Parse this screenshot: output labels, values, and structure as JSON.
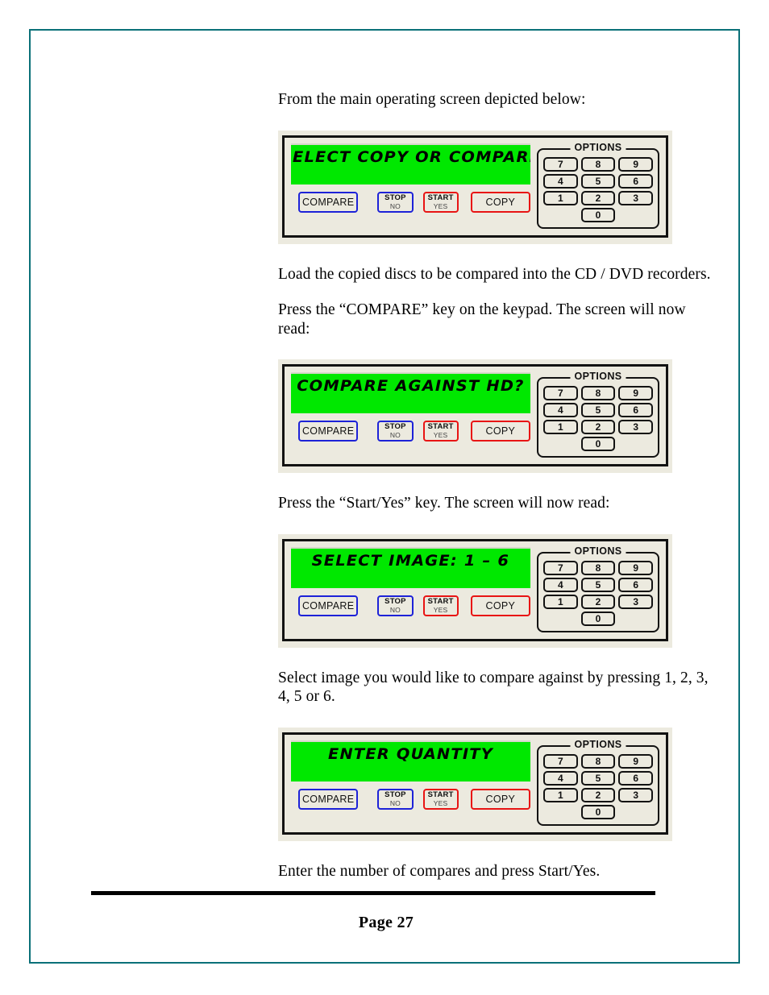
{
  "page": {
    "border_color": "#0a7078",
    "footer_page_label": "Page 27"
  },
  "paragraphs": {
    "intro": "From the main operating screen depicted below:",
    "load_discs": "Load the copied discs to be compared into the CD / DVD recorders.",
    "press_compare": "Press the “COMPARE” key on the keypad. The screen will now read:",
    "press_start_yes": "Press the “Start/Yes” key. The screen will now read:",
    "select_image": "Select image you would like to compare against by pressing 1, 2, 3, 4, 5 or 6.",
    "enter_compares": "Enter the number of compares and press Start/Yes."
  },
  "panel_common": {
    "lcd_color": "#00e800",
    "panel_bg": "#eceadf",
    "keypad_legend": "OPTIONS",
    "keypad_keys": [
      "7",
      "8",
      "9",
      "4",
      "5",
      "6",
      "1",
      "2",
      "3"
    ],
    "keypad_zero": "0",
    "buttons": {
      "compare": {
        "label": "COMPARE",
        "color": "#1d22d8"
      },
      "stop": {
        "line1": "STOP",
        "line2": "NO",
        "color": "#1d22d8"
      },
      "start": {
        "line1": "START",
        "line2": "YES",
        "color": "#e81414"
      },
      "copy": {
        "label": "COPY",
        "color": "#e81414"
      }
    }
  },
  "panels": [
    {
      "id": "panel-select-copy-or-compare",
      "lcd_text": "SELECT COPY OR COMPARE"
    },
    {
      "id": "panel-compare-against-hd",
      "lcd_text": "COMPARE AGAINST HD?"
    },
    {
      "id": "panel-select-image",
      "lcd_text": "SELECT IMAGE: 1 – 6"
    },
    {
      "id": "panel-enter-quantity",
      "lcd_text": "ENTER QUANTITY"
    }
  ]
}
